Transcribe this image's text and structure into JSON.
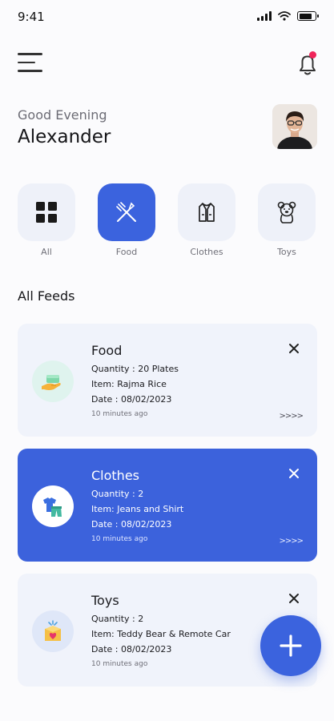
{
  "status": {
    "time": "9:41"
  },
  "header": {
    "greeting": "Good Evening",
    "name": "Alexander"
  },
  "categories": [
    {
      "label": "All",
      "icon": "grid-icon",
      "active": false
    },
    {
      "label": "Food",
      "icon": "fork-knife-icon",
      "active": true
    },
    {
      "label": "Clothes",
      "icon": "vest-icon",
      "active": false
    },
    {
      "label": "Toys",
      "icon": "teddy-bear-icon",
      "active": false
    }
  ],
  "feeds_title": "All Feeds",
  "feeds": [
    {
      "title": "Food",
      "quantity": "Quantity : 20 Plates",
      "item": "Item: Rajma Rice",
      "date": "Date : 08/02/2023",
      "time": "10 minutes ago",
      "icon": "food-bowl-icon"
    },
    {
      "title": "Clothes",
      "quantity": "Quantity : 2",
      "item": "Item: Jeans and Shirt",
      "date": "Date : 08/02/2023",
      "time": "10 minutes ago",
      "icon": "shirt-jeans-icon"
    },
    {
      "title": "Toys",
      "quantity": "Quantity : 2",
      "item": "Item: Teddy Bear & Remote Car",
      "date": "Date : 08/02/2023",
      "time": "10 minutes ago",
      "icon": "gift-box-icon"
    }
  ],
  "chevrons": ">>>>",
  "colors": {
    "accent": "#3b63de",
    "notification_dot": "#f0245a"
  }
}
